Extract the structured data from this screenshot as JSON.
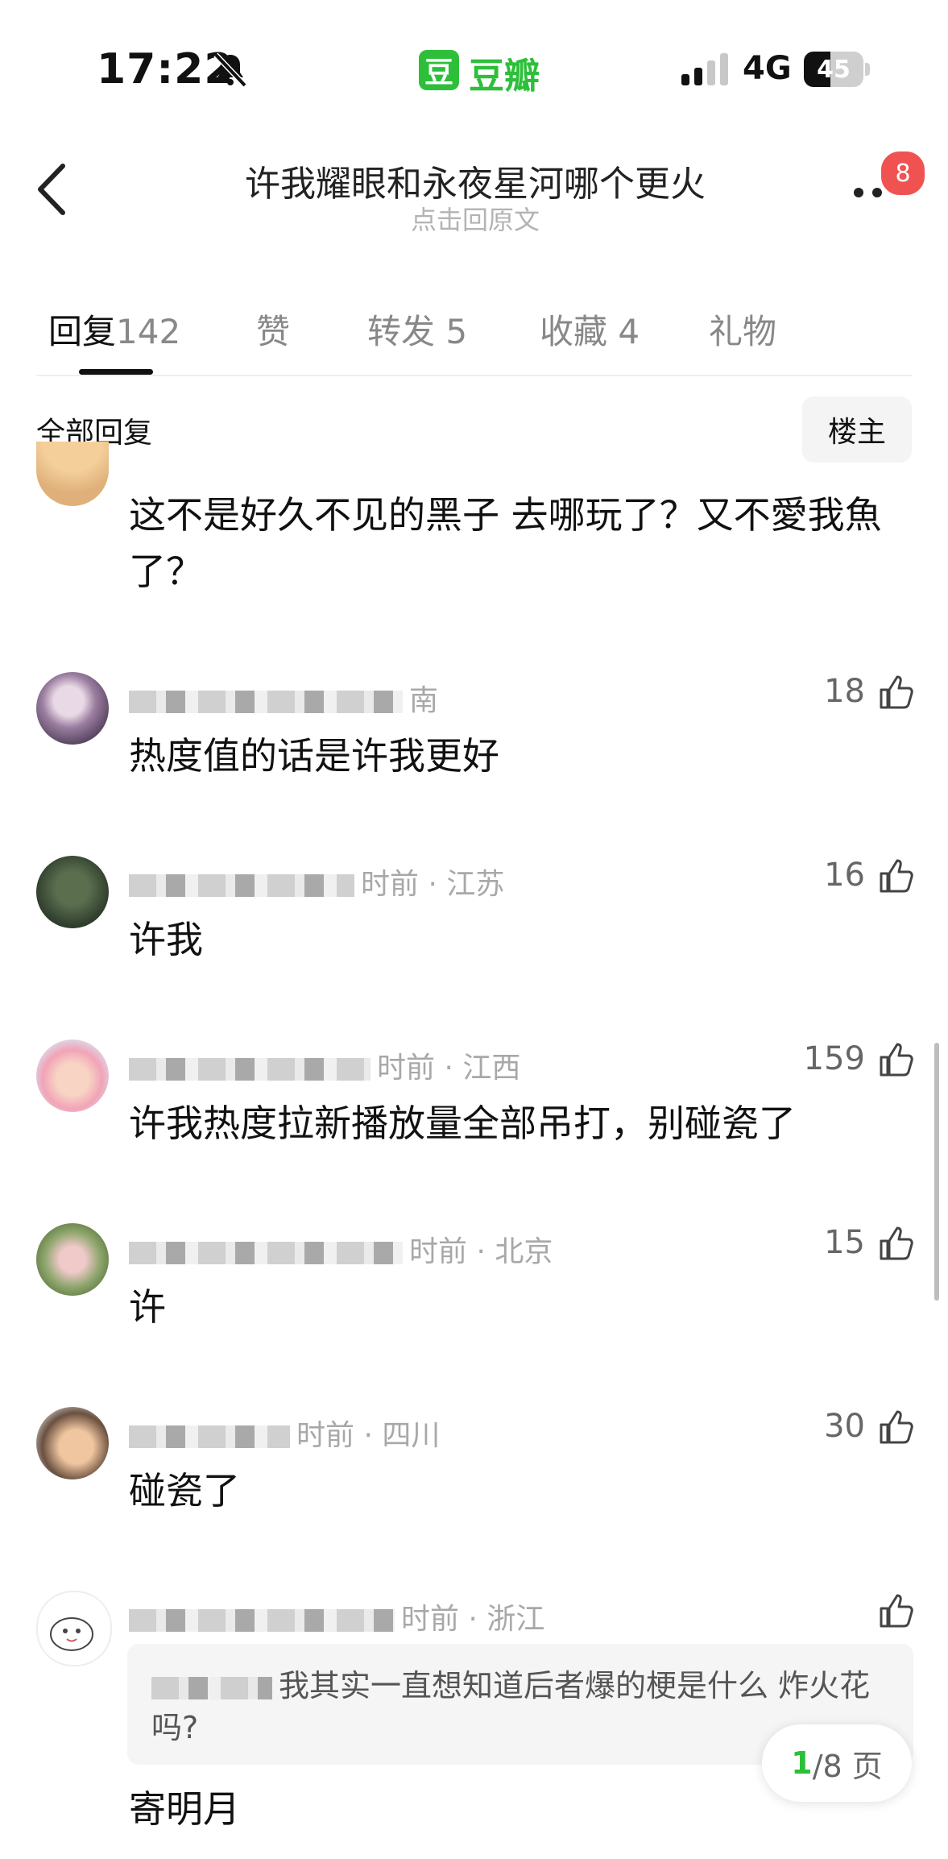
{
  "status": {
    "time": "17:22",
    "network": "4G",
    "battery": "45",
    "battery_level": 0.45
  },
  "app": {
    "icon_char": "豆",
    "name": "豆瓣",
    "brand_color": "#2dbf3a"
  },
  "nav": {
    "title": "许我耀眼和永夜星河哪个更火",
    "subtitle": "点击回原文",
    "more_badge": "8"
  },
  "tabs": [
    {
      "label": "回复",
      "count": "142"
    },
    {
      "label": "赞",
      "count": ""
    },
    {
      "label": "转发",
      "count": "5"
    },
    {
      "label": "收藏",
      "count": "4"
    },
    {
      "label": "礼物",
      "count": ""
    }
  ],
  "filter": {
    "label": "全部回复",
    "op_button": "楼主"
  },
  "comments": [
    {
      "meta": "",
      "likes": "",
      "text": "这不是好久不见的黑子 去哪玩了？又不愛我魚了？"
    },
    {
      "meta": "南",
      "likes": "18",
      "text": "热度值的话是许我更好"
    },
    {
      "meta": "时前 · 江苏",
      "likes": "16",
      "text": "许我"
    },
    {
      "meta": "时前 · 江西",
      "likes": "159",
      "text": "许我热度拉新播放量全部吊打，别碰瓷了"
    },
    {
      "meta": "时前 · 北京",
      "likes": "15",
      "text": "许"
    },
    {
      "meta": "时前 · 四川",
      "likes": "30",
      "text": "碰瓷了"
    },
    {
      "meta": "时前 · 浙江",
      "likes": "",
      "text": "寄明月",
      "quote": "我其实一直想知道后者爆的梗是什么 炸火花吗?"
    }
  ],
  "pager": {
    "current": "1",
    "total": "/8 页"
  }
}
